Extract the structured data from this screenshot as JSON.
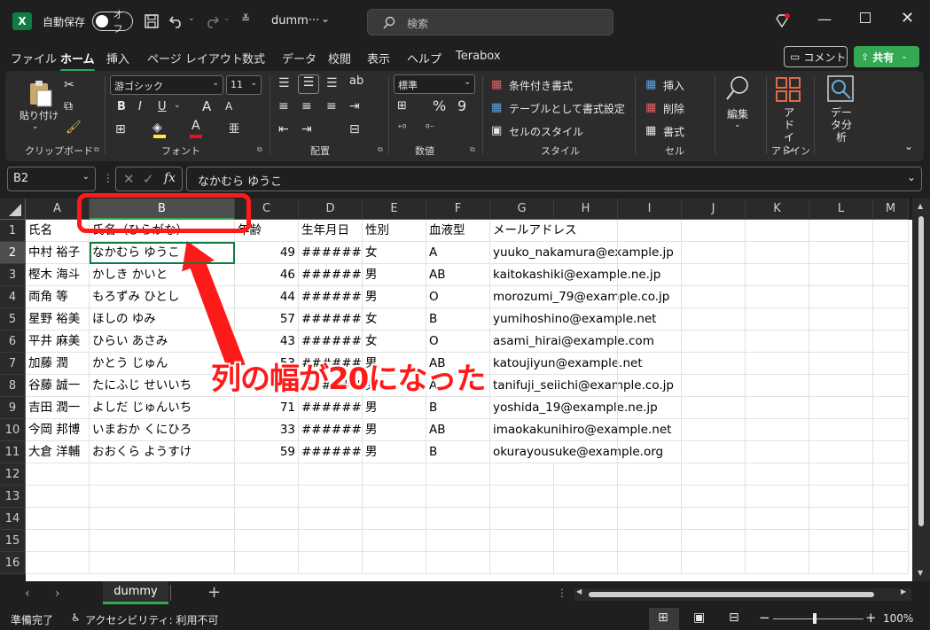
{
  "titlebar": {
    "logo": "X",
    "autosave_label": "自動保存",
    "autosave_state": "オフ",
    "filename": "dumm···",
    "search_placeholder": "検索"
  },
  "tabs": [
    "ファイル",
    "ホーム",
    "挿入",
    "ページ レイアウト",
    "数式",
    "データ",
    "校閲",
    "表示",
    "ヘルプ",
    "Terabox"
  ],
  "active_tab": "ホーム",
  "comment_button": "コメント",
  "share_button": "共有",
  "ribbon": {
    "clipboard": {
      "paste": "貼り付け",
      "label": "クリップボード"
    },
    "font": {
      "name": "游ゴシック",
      "size": "11",
      "label": "フォント",
      "bold": "B",
      "italic": "I",
      "underline": "U",
      "grow": "A",
      "shrink": "A"
    },
    "align": {
      "label": "配置"
    },
    "number": {
      "format": "標準",
      "label": "数値",
      "percent": "%",
      "comma": "9"
    },
    "style": {
      "cond": "条件付き書式",
      "table": "テーブルとして書式設定",
      "cell": "セルのスタイル",
      "label": "スタイル"
    },
    "cells": {
      "insert": "挿入",
      "delete": "削除",
      "format": "書式",
      "label": "セル"
    },
    "edit": {
      "label": "編集"
    },
    "addin": {
      "label": "アドイン",
      "button": "アドイン"
    },
    "analysis": {
      "label": "データ分析"
    }
  },
  "formula_bar": {
    "name_box": "B2",
    "fx": "fx",
    "value": "なかむら ゆうこ"
  },
  "columns": [
    "A",
    "B",
    "C",
    "D",
    "E",
    "F",
    "G",
    "H",
    "I",
    "J",
    "K",
    "L",
    "M"
  ],
  "selected_column": "B",
  "rows": [
    [
      "氏名",
      "氏名（ひらがな）",
      "年齢",
      "生年月日",
      "性別",
      "血液型",
      "メールアドレス"
    ],
    [
      "中村 裕子",
      "なかむら ゆうこ",
      "49",
      "#######",
      "女",
      "A",
      "yuuko_nakamura@example.jp"
    ],
    [
      "樫木 海斗",
      "かしき かいと",
      "46",
      "#######",
      "男",
      "AB",
      "kaitokashiki@example.ne.jp"
    ],
    [
      "両角 等",
      "もろずみ ひとし",
      "44",
      "#######",
      "男",
      "O",
      "morozumi_79@example.co.jp"
    ],
    [
      "星野 裕美",
      "ほしの ゆみ",
      "57",
      "#######",
      "女",
      "B",
      "yumihoshino@example.net"
    ],
    [
      "平井 麻美",
      "ひらい あさみ",
      "43",
      "#######",
      "女",
      "O",
      "asami_hirai@example.com"
    ],
    [
      "加藤 潤",
      "かとう じゅん",
      "53",
      "#######",
      "男",
      "AB",
      "katoujiyun@example.net"
    ],
    [
      "谷藤 誠一",
      "たにふじ せいいち",
      "76",
      "#######",
      "男",
      "A",
      "tanifuji_seiichi@example.co.jp"
    ],
    [
      "吉田 潤一",
      "よしだ じゅんいち",
      "71",
      "#######",
      "男",
      "B",
      "yoshida_19@example.ne.jp"
    ],
    [
      "今岡 邦博",
      "いまおか くにひろ",
      "33",
      "#######",
      "男",
      "AB",
      "imaokakunihiro@example.net"
    ],
    [
      "大倉 洋輔",
      "おおくら ようすけ",
      "59",
      "#######",
      "男",
      "B",
      "okurayousuke@example.org"
    ]
  ],
  "row_numbers": [
    "1",
    "2",
    "3",
    "4",
    "5",
    "6",
    "7",
    "8",
    "9",
    "10",
    "11",
    "12",
    "13",
    "14",
    "15",
    "16"
  ],
  "sheet_tab": "dummy",
  "add_sheet": "+",
  "status": {
    "ready": "準備完了",
    "accessibility": "アクセシビリティ: 利用不可",
    "zoom": "100%"
  },
  "annotation": "列の幅が20になった",
  "colors": {
    "accent": "#34a853",
    "excel_green": "#107c41",
    "annotation_red": "#ff1a1a"
  }
}
